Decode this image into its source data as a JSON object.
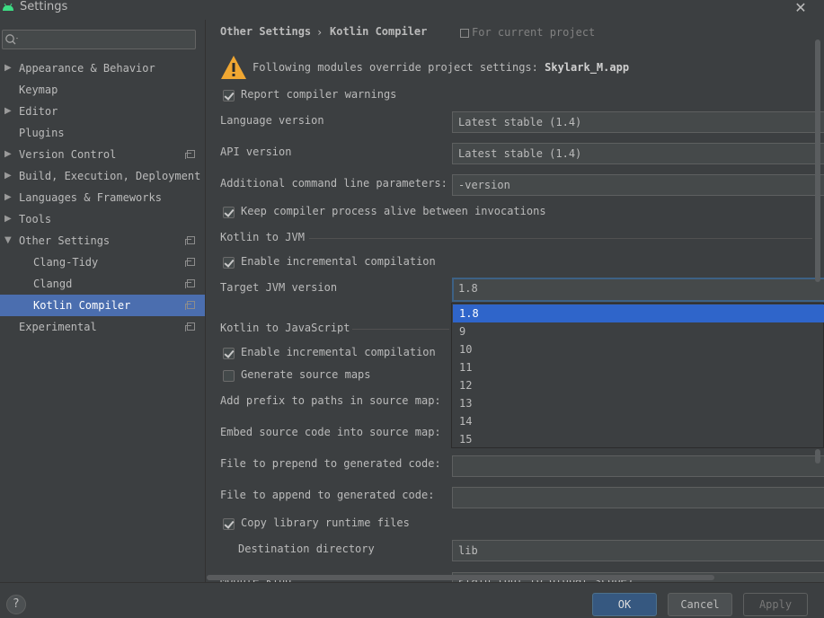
{
  "window": {
    "title": "Settings"
  },
  "sidebar": {
    "search_placeholder": "",
    "items": [
      {
        "label": "Appearance & Behavior",
        "expandable": true
      },
      {
        "label": "Keymap"
      },
      {
        "label": "Editor",
        "expandable": true
      },
      {
        "label": "Plugins"
      },
      {
        "label": "Version Control",
        "expandable": true,
        "project_scope": true
      },
      {
        "label": "Build, Execution, Deployment",
        "expandable": true
      },
      {
        "label": "Languages & Frameworks",
        "expandable": true
      },
      {
        "label": "Tools",
        "expandable": true
      },
      {
        "label": "Other Settings",
        "expanded": true,
        "project_scope": true
      },
      {
        "label": "Clang-Tidy",
        "child": true,
        "project_scope": true
      },
      {
        "label": "Clangd",
        "child": true,
        "project_scope": true
      },
      {
        "label": "Kotlin Compiler",
        "child": true,
        "selected": true,
        "project_scope": true
      },
      {
        "label": "Experimental",
        "project_scope": true
      }
    ]
  },
  "breadcrumb": {
    "parent": "Other Settings",
    "separator": "›",
    "current": "Kotlin Compiler",
    "scope_note": "For current project"
  },
  "warning": {
    "text": "Following modules override project settings:",
    "module": "Skylark_M.app"
  },
  "options": {
    "report_warnings": {
      "label": "Report compiler warnings",
      "checked": true
    },
    "language_version": {
      "label": "Language version",
      "value": "Latest stable (1.4)"
    },
    "api_version": {
      "label": "API version",
      "value": "Latest stable (1.4)"
    },
    "cmd_params": {
      "label": "Additional command line parameters:",
      "value": "-version"
    },
    "keep_alive": {
      "label": "Keep compiler process alive between invocations",
      "checked": true
    }
  },
  "jvm": {
    "section": "Kotlin to JVM",
    "incremental": {
      "label": "Enable incremental compilation",
      "checked": true
    },
    "target": {
      "label": "Target JVM version",
      "value": "1.8"
    },
    "target_options": [
      "1.8",
      "9",
      "10",
      "11",
      "12",
      "13",
      "14",
      "15"
    ]
  },
  "js": {
    "section": "Kotlin to JavaScript",
    "incremental": {
      "label": "Enable incremental compilation",
      "checked": true
    },
    "source_maps": {
      "label": "Generate source maps",
      "checked": false
    },
    "prefix": {
      "label": "Add prefix to paths in source map:"
    },
    "embed": {
      "label": "Embed source code into source map:"
    },
    "prepend": {
      "label": "File to prepend to generated code:",
      "value": ""
    },
    "append": {
      "label": "File to append to generated code:",
      "value": ""
    },
    "copy_runtime": {
      "label": "Copy library runtime files",
      "checked": true
    },
    "destination": {
      "label": "Destination directory",
      "value": "lib"
    },
    "module_kind": {
      "label": "Module kind:",
      "value": "Plain (put to global scope)"
    }
  },
  "buttons": {
    "help": "?",
    "ok": "OK",
    "cancel": "Cancel",
    "apply": "Apply"
  },
  "colors": {
    "background": "#3c3f41",
    "selection": "#4b6eaf",
    "dropdown_selection": "#2f65ca",
    "warning": "#f0a732"
  }
}
